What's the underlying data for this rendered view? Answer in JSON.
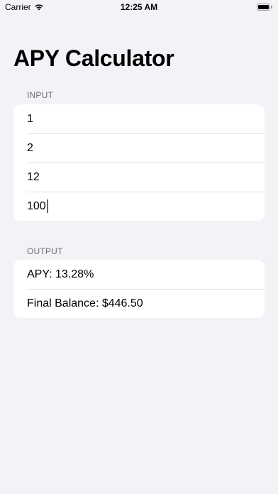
{
  "status_bar": {
    "carrier": "Carrier",
    "time": "12:25 AM",
    "icons": [
      "wifi-icon",
      "battery-icon"
    ]
  },
  "title": "APY Calculator",
  "input_section": {
    "header": "INPUT",
    "fields": [
      {
        "value": "1"
      },
      {
        "value": "2"
      },
      {
        "value": "12"
      },
      {
        "value": "100",
        "focused": true
      }
    ]
  },
  "output_section": {
    "header": "OUTPUT",
    "rows": [
      {
        "text": "APY: 13.28%"
      },
      {
        "text": "Final Balance: $446.50"
      }
    ]
  },
  "colors": {
    "background": "#f2f2f7",
    "card": "#ffffff",
    "section_header": "#6d6d72",
    "cursor": "#1a73e8"
  }
}
